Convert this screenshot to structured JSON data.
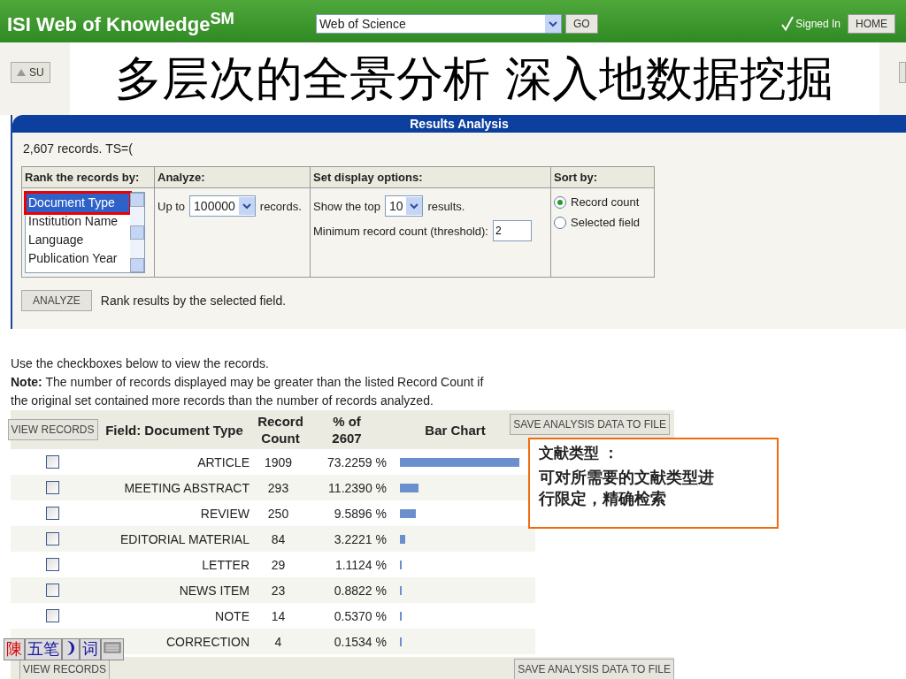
{
  "header": {
    "logo": "ISI Web of Knowledge",
    "logo_mark": "SM",
    "database_select": "Web of Science",
    "go_button": "GO",
    "signed_in": "Signed In",
    "home_button": "HOME"
  },
  "toolbar": {
    "button": "SU"
  },
  "slide_title": "多层次的全景分析 深入地数据挖掘",
  "panel": {
    "title": "Results Analysis",
    "summary": "2,607 records. TS=(",
    "rank_by": {
      "heading": "Rank the records by:",
      "items": [
        {
          "label": "Document Type",
          "selected": true
        },
        {
          "label": "Institution Name",
          "selected": false
        },
        {
          "label": "Language",
          "selected": false
        },
        {
          "label": "Publication Year",
          "selected": false
        }
      ]
    },
    "analyze": {
      "heading": "Analyze:",
      "prefix": "Up to",
      "value": "100000",
      "suffix": "records."
    },
    "display": {
      "heading": "Set display options:",
      "top_prefix": "Show the top",
      "top_value": "10",
      "top_suffix": "results.",
      "threshold_label": "Minimum record count (threshold):",
      "threshold_value": "2"
    },
    "sort": {
      "heading": "Sort by:",
      "items": [
        {
          "label": "Record count",
          "selected": true
        },
        {
          "label": "Selected field",
          "selected": false
        }
      ]
    },
    "analyze_button": "ANALYZE",
    "analyze_hint": "Rank results by the selected field."
  },
  "instructions": "Use the checkboxes below to view the records.",
  "note": "**Note:** The number of records displayed may be greater than the listed Record Count if the original set contained more records than the number of records analyzed.",
  "results": {
    "view_button": "VIEW RECORDS",
    "columns": [
      "Field: Document Type",
      "Record Count",
      "% of 2607",
      "Bar Chart"
    ],
    "save_button": "SAVE ANALYSIS DATA TO FILE",
    "rows": [
      {
        "field": "ARTICLE",
        "count": "1909",
        "percent": "73.2259 %",
        "checked": false
      },
      {
        "field": "MEETING ABSTRACT",
        "count": "293",
        "percent": "11.2390 %",
        "checked": false
      },
      {
        "field": "REVIEW",
        "count": "250",
        "percent": "9.5896 %",
        "checked": false
      },
      {
        "field": "EDITORIAL MATERIAL",
        "count": "84",
        "percent": "3.2221 %",
        "checked": false
      },
      {
        "field": "LETTER",
        "count": "29",
        "percent": "1.1124 %",
        "checked": false
      },
      {
        "field": "NEWS ITEM",
        "count": "23",
        "percent": "0.8822 %",
        "checked": false
      },
      {
        "field": "NOTE",
        "count": "14",
        "percent": "0.5370 %",
        "checked": false
      },
      {
        "field": "CORRECTION",
        "count": "4",
        "percent": "0.1534 %"
      }
    ],
    "footer_view_button": "VIEW RECORDS",
    "footer_save_button": "SAVE ANALYSIS DATA TO FILE"
  },
  "callout": {
    "title": "文献类型 ：",
    "body": "可对所需要的文献类型进行限定，精确检索"
  },
  "ime_toolbar": {
    "logo": "陳",
    "mode": "五笔",
    "words": "词"
  }
}
